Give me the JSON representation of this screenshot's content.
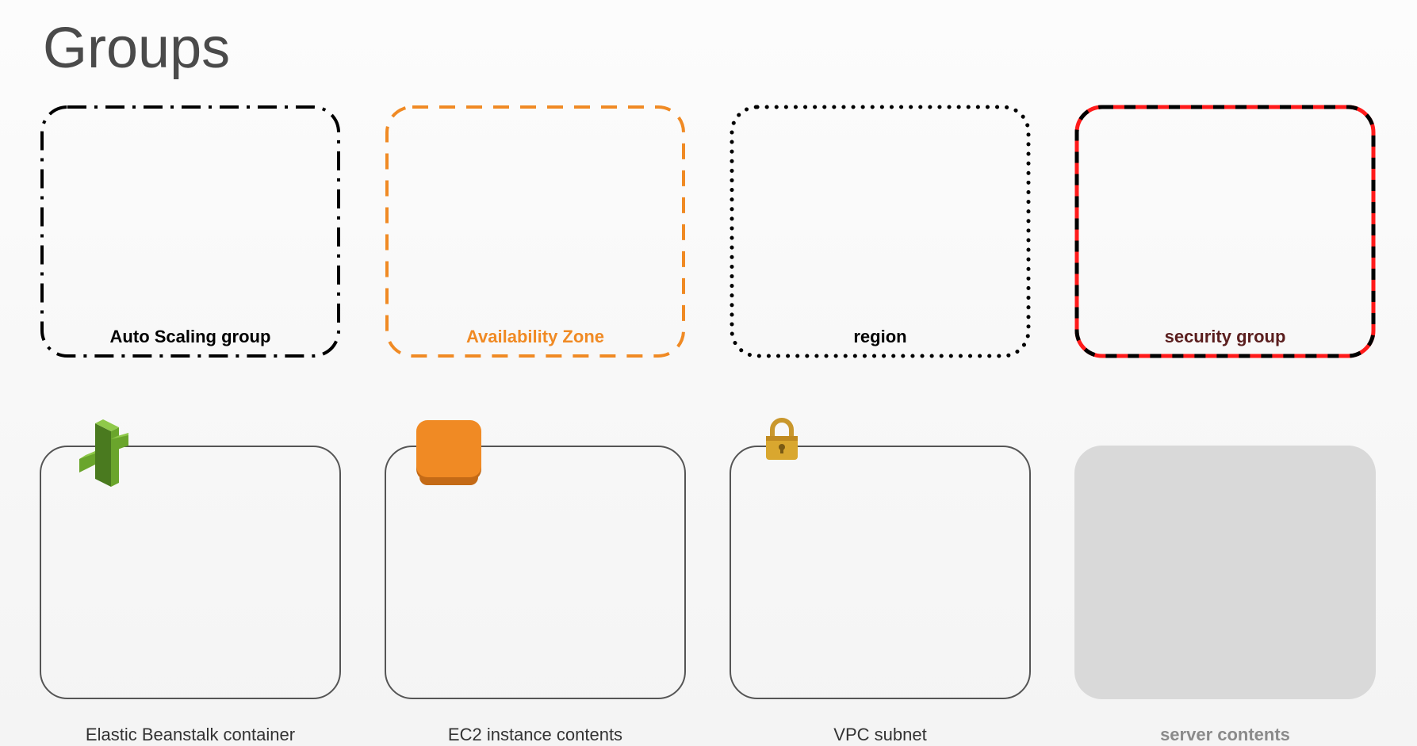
{
  "title": "Groups",
  "row1": {
    "auto_scaling": {
      "label": "Auto Scaling group"
    },
    "availability_zone": {
      "label": "Availability Zone"
    },
    "region": {
      "label": "region"
    },
    "security_group": {
      "label": "security group"
    }
  },
  "row2": {
    "beanstalk": {
      "label": "Elastic Beanstalk container"
    },
    "ec2": {
      "label": "EC2 instance contents"
    },
    "vpc": {
      "label": "VPC subnet"
    },
    "server": {
      "label": "server contents"
    }
  },
  "colors": {
    "orange": "#f08a24",
    "red": "#ff1a1a",
    "darkred": "#5a1e1e",
    "grey_fill": "#d9d9d9"
  }
}
